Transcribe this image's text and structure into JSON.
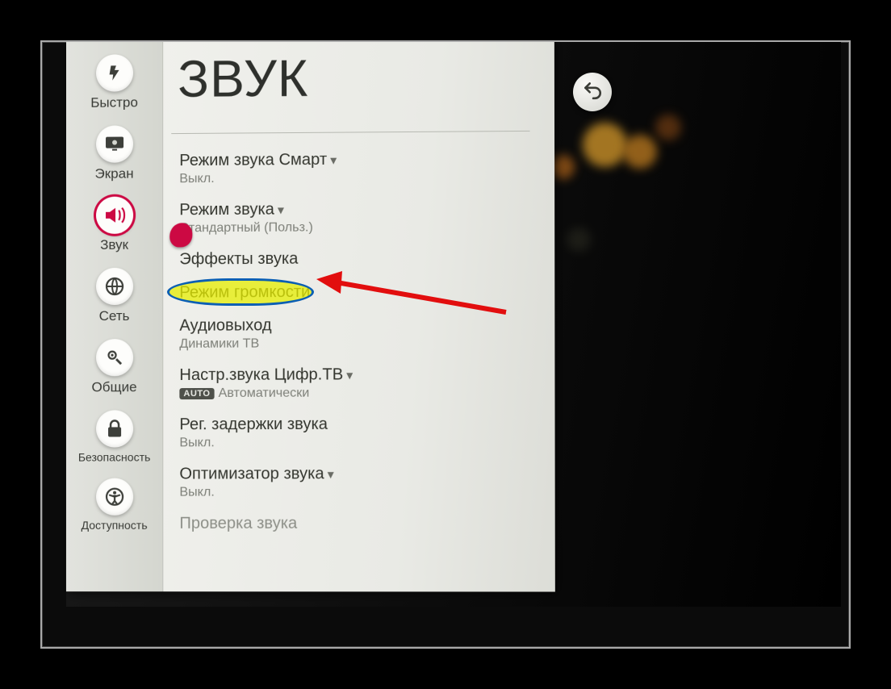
{
  "page": {
    "title": "ЗВУК"
  },
  "rail": {
    "items": [
      {
        "label": "Быстро",
        "icon": "bolt-icon"
      },
      {
        "label": "Экран",
        "icon": "display-icon"
      },
      {
        "label": "Звук",
        "icon": "speaker-icon",
        "active": true
      },
      {
        "label": "Сеть",
        "icon": "globe-icon"
      },
      {
        "label": "Общие",
        "icon": "gear-icon"
      },
      {
        "label": "Безопасность",
        "icon": "lock-icon"
      },
      {
        "label": "Доступность",
        "icon": "accessibility-icon"
      }
    ]
  },
  "settings": [
    {
      "title": "Режим звука Смарт",
      "chevron": true,
      "value": "Выкл."
    },
    {
      "title": "Режим звука",
      "chevron": true,
      "value": "Стандартный (Польз.)"
    },
    {
      "title": "Эффекты звука",
      "chevron": false,
      "value": "",
      "highlight": true
    },
    {
      "title": "Режим громкости",
      "chevron": false,
      "value": ""
    },
    {
      "title": "Аудиовыход",
      "chevron": false,
      "value": "Динамики ТВ"
    },
    {
      "title": "Настр.звука Цифр.ТВ",
      "chevron": true,
      "value": "Автоматически",
      "badge": "AUTO"
    },
    {
      "title": "Рег. задержки звука",
      "chevron": false,
      "value": "Выкл."
    },
    {
      "title": "Оптимизатор звука",
      "chevron": true,
      "value": "Выкл."
    },
    {
      "title": "Проверка звука",
      "chevron": false,
      "value": "",
      "disabled": true
    }
  ],
  "back_button": {
    "label": "↶"
  }
}
